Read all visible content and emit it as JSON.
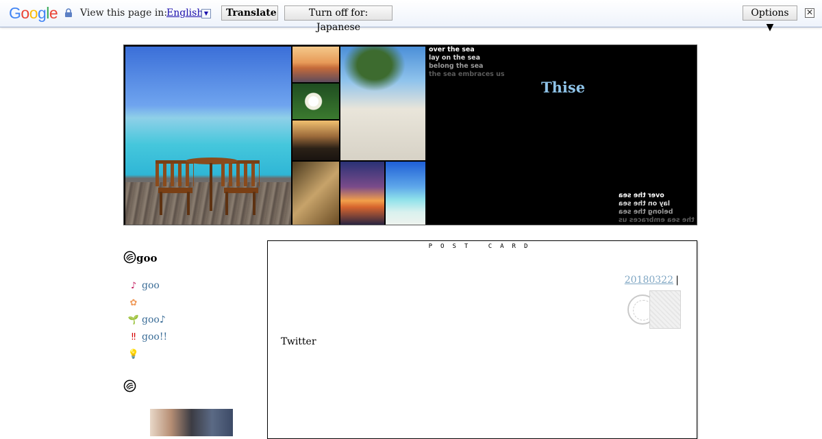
{
  "translate_bar": {
    "logo_letters": [
      {
        "char": "G",
        "color": "#4285F4"
      },
      {
        "char": "o",
        "color": "#EA4335"
      },
      {
        "char": "o",
        "color": "#FBBC05"
      },
      {
        "char": "g",
        "color": "#4285F4"
      },
      {
        "char": "l",
        "color": "#34A853"
      },
      {
        "char": "e",
        "color": "#EA4335"
      }
    ],
    "lock_icon": "lock-icon",
    "view_text": "View this page in:",
    "language": "English",
    "language_arrow": "▼",
    "translate_label": "Translate",
    "turn_off_label": "Turn off for: Japanese",
    "options_label": "Options ▼",
    "close_label": "✕"
  },
  "banner": {
    "title": "Thise",
    "sea_lines": [
      "over the sea",
      "lay on the sea",
      "belong the sea",
      "the sea embraces us"
    ]
  },
  "sidebar": {
    "heading": "goo",
    "items": [
      {
        "icon": "♪",
        "icon_color": "#c2185b",
        "label": "goo"
      },
      {
        "icon": "✿",
        "icon_color": "#f09a5a",
        "label": ""
      },
      {
        "icon": "🌱",
        "icon_color": "#2e8b2e",
        "label": "goo♪"
      },
      {
        "icon": "‼",
        "icon_color": "#d50000",
        "label": "goo!!"
      },
      {
        "icon": "💡",
        "icon_color": "#e0a800",
        "label": ""
      }
    ],
    "heading2": ""
  },
  "post": {
    "header": "POST CARD",
    "date": "20180322",
    "separator": "|",
    "body": "Twitter"
  },
  "colors": {
    "accent_link": "#3b6d97",
    "date_link": "#7fa6c3",
    "banner_title": "#8ec3e8"
  }
}
